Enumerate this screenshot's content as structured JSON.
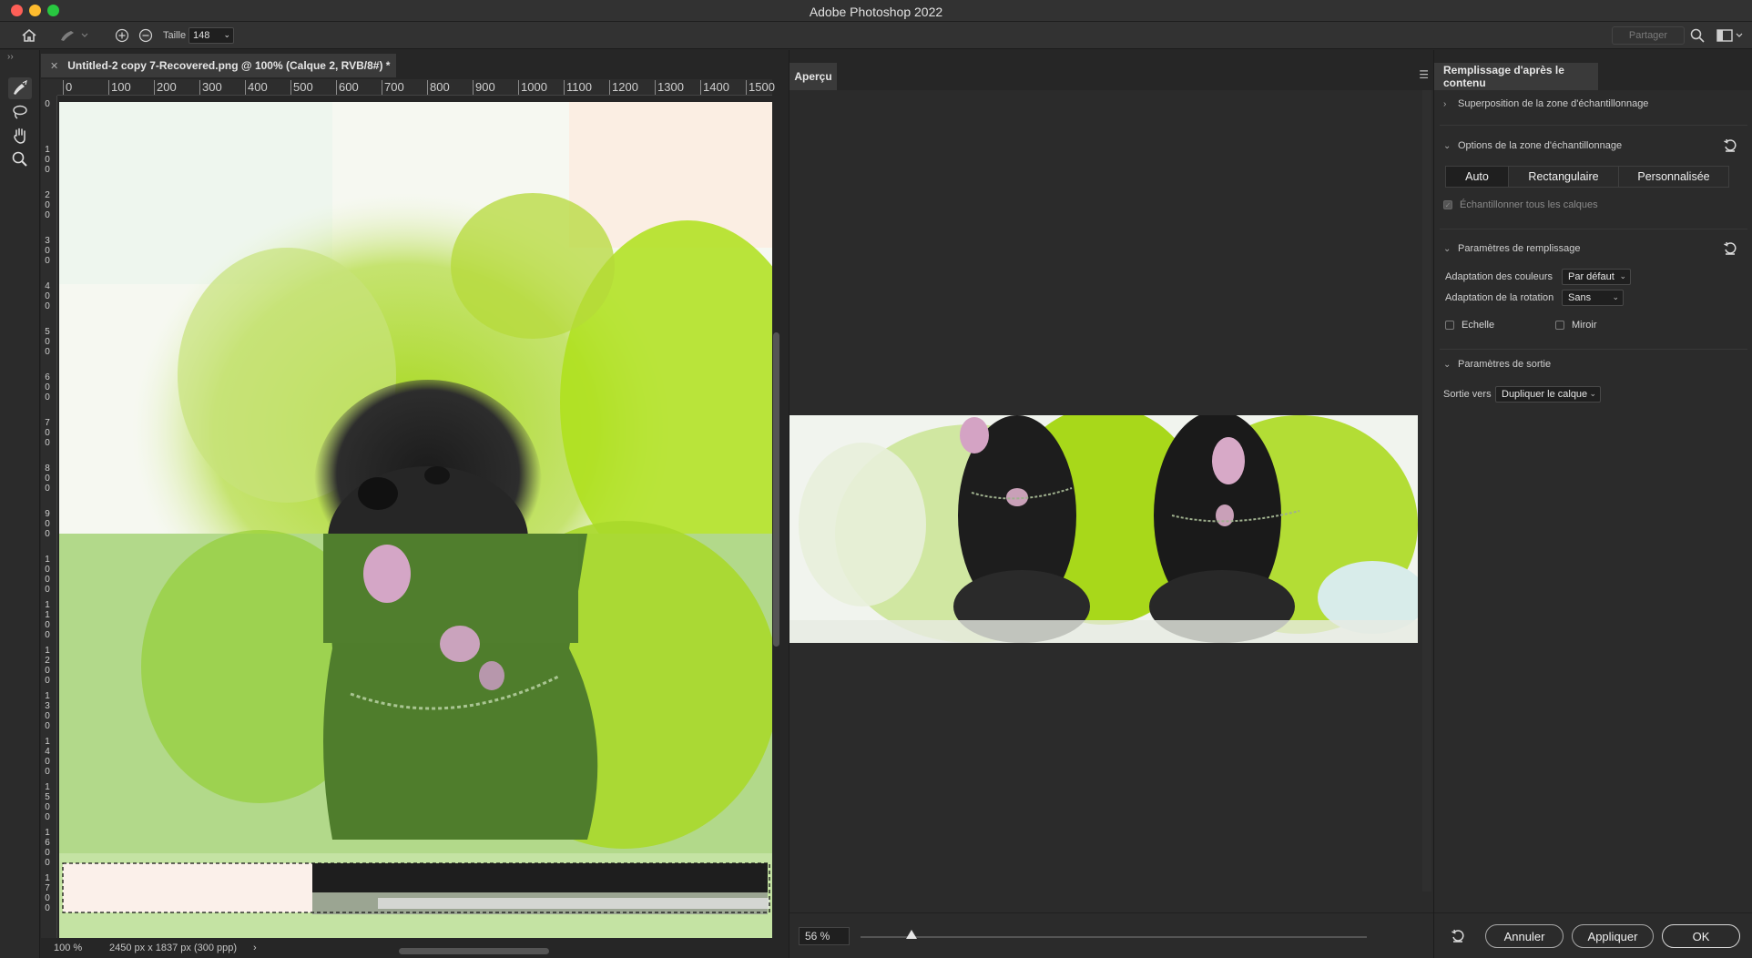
{
  "window": {
    "title": "Adobe Photoshop 2022"
  },
  "options_bar": {
    "size_label": "Taille",
    "size_value": "148",
    "share_label": "Partager"
  },
  "document": {
    "tab_title": "Untitled-2 copy 7-Recovered.png @ 100% (Calque 2, RVB/8#) *",
    "ruler_top_ticks": [
      "0",
      "100",
      "200",
      "300",
      "400",
      "500",
      "600",
      "700",
      "800",
      "900",
      "1000",
      "1100",
      "1200",
      "1300",
      "1400",
      "1500"
    ],
    "ruler_left_ticks": [
      "0",
      "100",
      "200",
      "300",
      "400",
      "500",
      "600",
      "700",
      "800",
      "900",
      "1000",
      "1100",
      "1200",
      "1300",
      "1400",
      "1500",
      "1600",
      "1700"
    ],
    "zoom": "100 %",
    "dimensions": "2450 px x 1837 px (300 ppp)",
    "status_arrow": "›"
  },
  "preview": {
    "tab_label": "Aperçu",
    "zoom_value": "56 %",
    "zoom_fraction": 0.1
  },
  "right_panel": {
    "tab_label": "Remplissage d'après le contenu",
    "section_overlay": "Superposition de la zone d'échantillonnage",
    "section_sampling": "Options de la zone d'échantillonnage",
    "sampling_options": [
      "Auto",
      "Rectangulaire",
      "Personnalisée"
    ],
    "sampling_selected": "Auto",
    "sample_all_layers": "Échantillonner tous les calques",
    "section_fill": "Paramètres de remplissage",
    "color_adaptation_label": "Adaptation des couleurs",
    "color_adaptation_value": "Par défaut",
    "rotation_adaptation_label": "Adaptation de la rotation",
    "rotation_adaptation_value": "Sans",
    "scale_label": "Echelle",
    "mirror_label": "Miroir",
    "section_output": "Paramètres de sortie",
    "output_label": "Sortie vers",
    "output_value": "Dupliquer le calque",
    "buttons": {
      "cancel": "Annuler",
      "apply": "Appliquer",
      "ok": "OK"
    }
  },
  "colors": {
    "accent_green": "#9acd1a",
    "overlay_green": "#4d7a2a",
    "panel_bg": "#2b2b2b"
  }
}
